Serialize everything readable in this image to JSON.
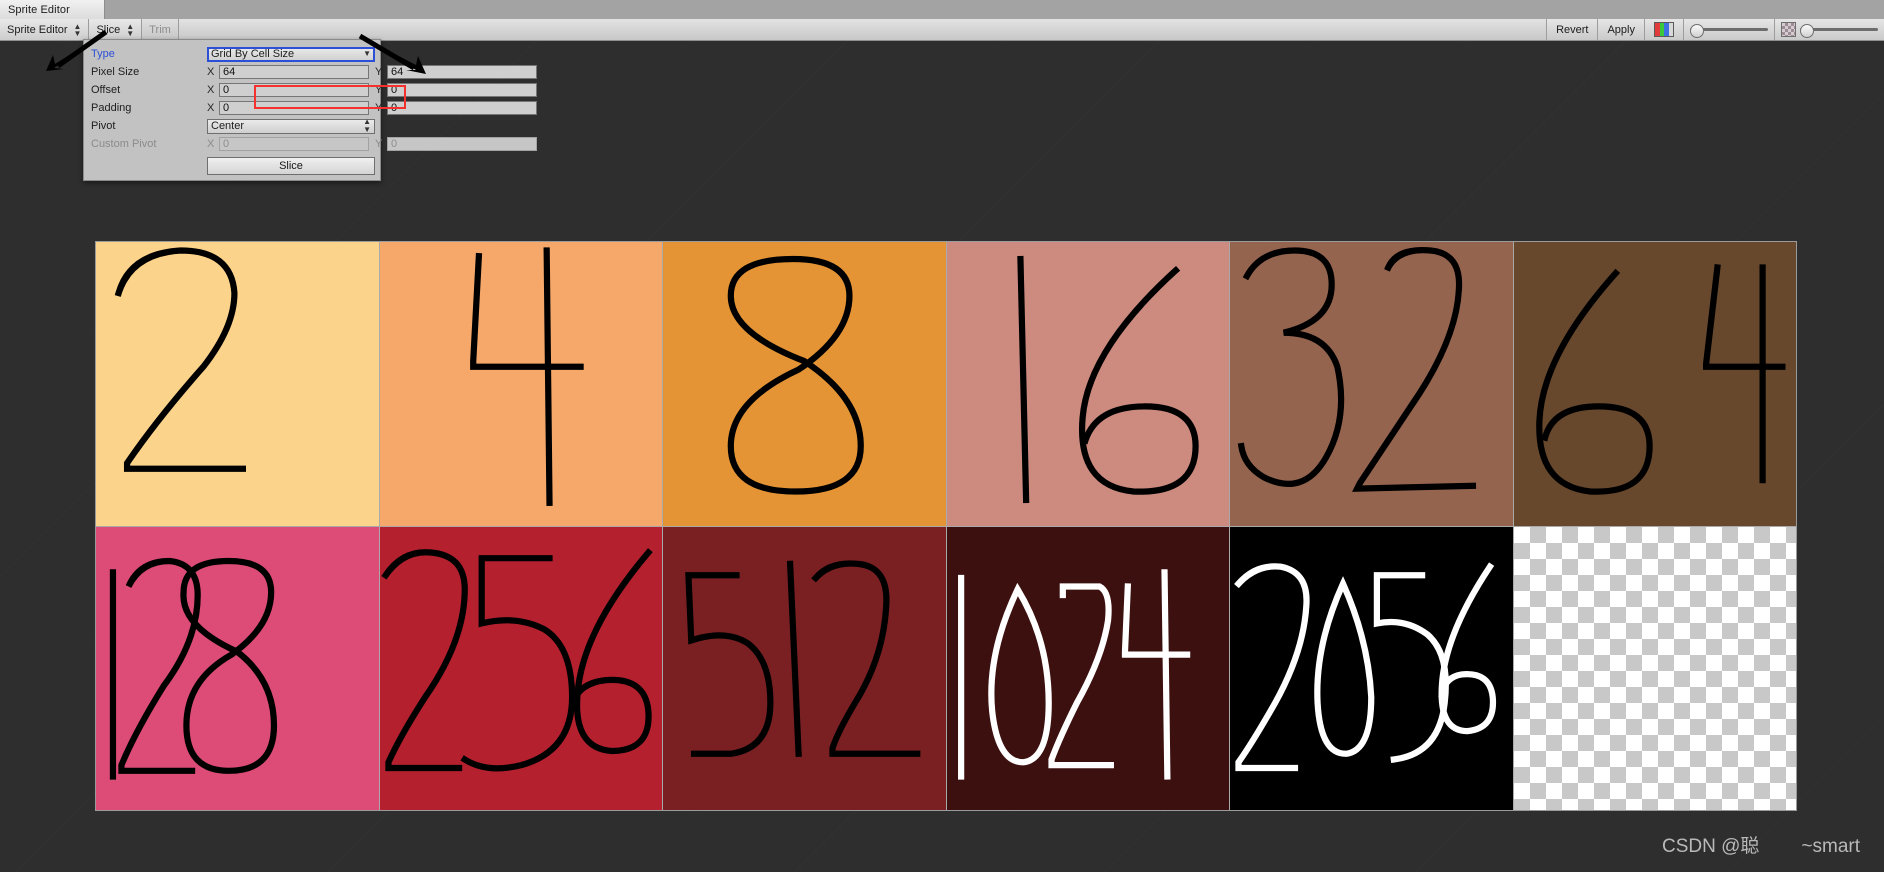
{
  "window": {
    "tab_label": "Sprite Editor",
    "background_color": "#2e2e2e"
  },
  "toolbar": {
    "left_items": [
      {
        "label": "Sprite Editor",
        "has_dropdown": true,
        "disabled": false
      },
      {
        "label": "Slice",
        "has_dropdown": true,
        "disabled": false
      },
      {
        "label": "Trim",
        "has_dropdown": false,
        "disabled": true
      }
    ],
    "right_items": [
      {
        "label": "Revert"
      },
      {
        "label": "Apply"
      }
    ],
    "rgba_swatch_colors": [
      "#e23b3b",
      "#3bc93b",
      "#3b6fe2",
      "#d8d8d8"
    ],
    "zoom_slider_value": 0,
    "alpha_slider_value": 0
  },
  "slice_panel": {
    "rows": [
      {
        "name": "type",
        "label": "Type",
        "kind": "dropdown",
        "value": "Grid By Cell Size"
      },
      {
        "name": "pixel_size",
        "label": "Pixel Size",
        "kind": "xy",
        "x_axis": "X",
        "y_axis": "Y",
        "x": "64",
        "y": "64",
        "highlighted": true
      },
      {
        "name": "offset",
        "label": "Offset",
        "kind": "xy",
        "x_axis": "X",
        "y_axis": "Y",
        "x": "0",
        "y": "0"
      },
      {
        "name": "padding",
        "label": "Padding",
        "kind": "xy",
        "x_axis": "X",
        "y_axis": "Y",
        "x": "0",
        "y": "0"
      },
      {
        "name": "pivot",
        "label": "Pivot",
        "kind": "dropdown",
        "value": "Center"
      },
      {
        "name": "custom_pivot",
        "label": "Custom Pivot",
        "kind": "xy",
        "x_axis": "X",
        "y_axis": "Y",
        "x": "0",
        "y": "0",
        "disabled": true
      }
    ],
    "slice_button_label": "Slice",
    "highlight_color": "#f4312d",
    "type_label_color": "#2b4fd6"
  },
  "annotations": {
    "arrow_1_target": "Slice menu button",
    "arrow_2_target": "Type dropdown"
  },
  "sprite_sheet": {
    "columns": 6,
    "rows": 2,
    "cells": [
      {
        "digit": "2",
        "bg": "#fcd38b",
        "ink": "#000000"
      },
      {
        "digit": "4",
        "bg": "#f5a86a",
        "ink": "#000000"
      },
      {
        "digit": "8",
        "bg": "#e59435",
        "ink": "#000000"
      },
      {
        "digit": "16",
        "bg": "#cd8b80",
        "ink": "#000000"
      },
      {
        "digit": "32",
        "bg": "#95644f",
        "ink": "#000000"
      },
      {
        "digit": "64",
        "bg": "#68482c",
        "ink": "#000000"
      },
      {
        "digit": "128",
        "bg": "#dd4b77",
        "ink": "#000000"
      },
      {
        "digit": "256",
        "bg": "#b5202e",
        "ink": "#000000"
      },
      {
        "digit": "512",
        "bg": "#7a2023",
        "ink": "#000000"
      },
      {
        "digit": "1024",
        "bg": "#3d1010",
        "ink": "#ffffff"
      },
      {
        "digit": "2056",
        "bg": "#000000",
        "ink": "#ffffff"
      },
      {
        "digit": "",
        "bg": "transparent",
        "ink": "#000000",
        "transparent": true
      }
    ]
  },
  "watermark": {
    "left": "CSDN @聪",
    "right": "~smart"
  }
}
